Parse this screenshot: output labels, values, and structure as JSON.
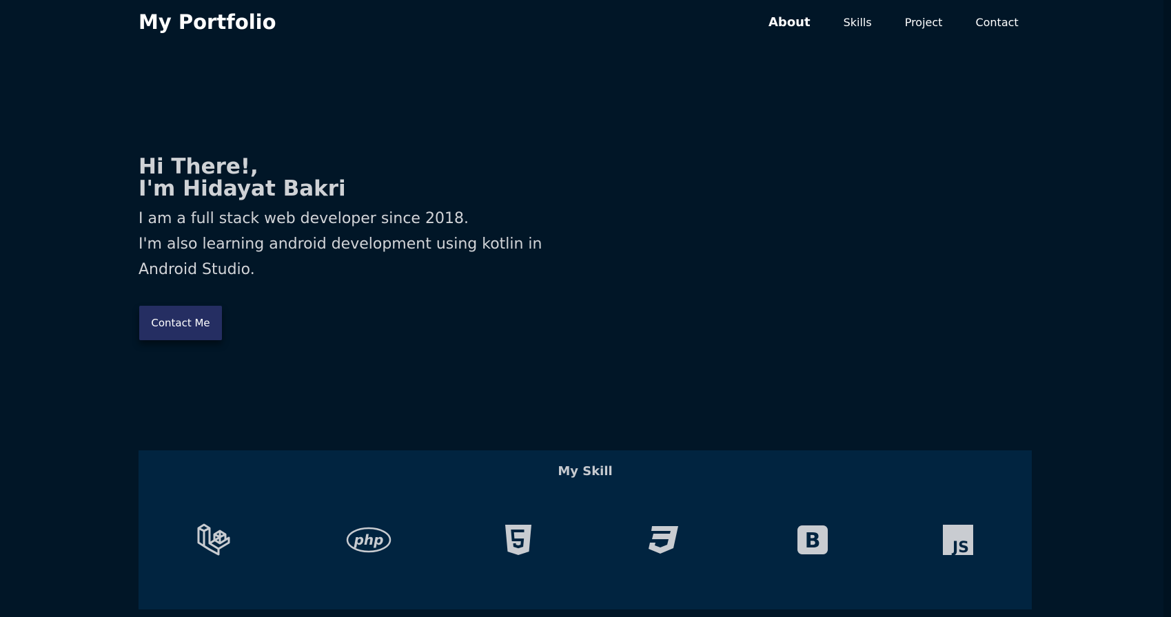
{
  "header": {
    "brand": "My Portfolio",
    "nav": [
      {
        "label": "About",
        "active": true
      },
      {
        "label": "Skills",
        "active": false
      },
      {
        "label": "Project",
        "active": false
      },
      {
        "label": "Contact",
        "active": false
      }
    ]
  },
  "hero": {
    "greeting": "Hi There!,",
    "name_line": "I'm Hidayat Bakri",
    "desc_line1": "I am a full stack web developer since 2018.",
    "desc_line2": "I'm also learning android development using kotlin in Android Studio.",
    "cta_label": "Contact Me"
  },
  "skills": {
    "title": "My Skill",
    "icons": [
      "laravel-icon",
      "php-icon",
      "html5-icon",
      "css3-icon",
      "bootstrap-icon",
      "javascript-icon"
    ],
    "php_text": "php",
    "bootstrap_letter": "B",
    "js_text": "JS"
  },
  "colors": {
    "background": "#011627",
    "skills_panel": "#012440",
    "button": "#252e62",
    "icon": "#c9ccd1"
  }
}
